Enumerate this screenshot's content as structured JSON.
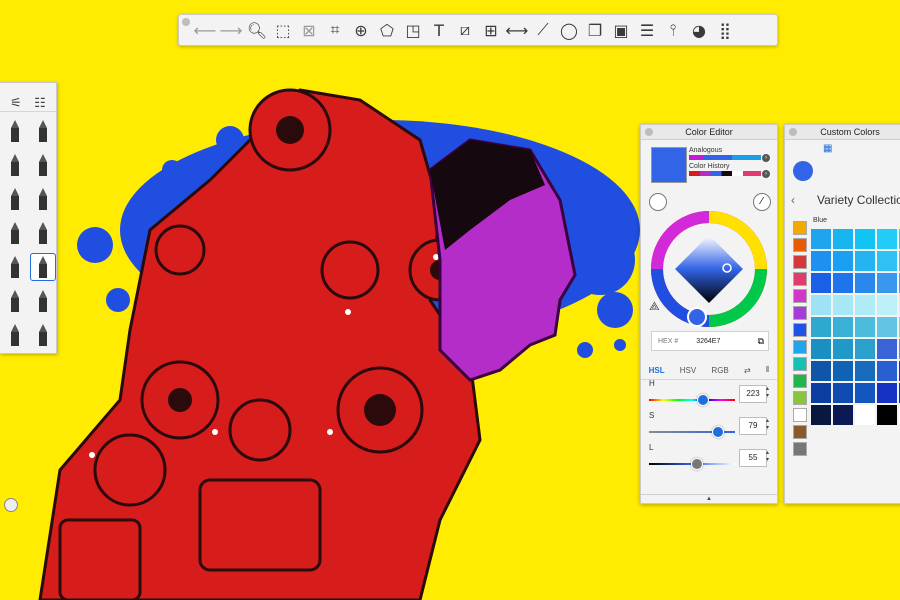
{
  "app": {
    "toolbar": {
      "tools": [
        {
          "icon": "undo-icon",
          "glyph": "⟵",
          "dim": true
        },
        {
          "icon": "redo-icon",
          "glyph": "⟶",
          "dim": true
        },
        {
          "icon": "zoom-icon",
          "glyph": "🔍︎"
        },
        {
          "icon": "select-rect-icon",
          "glyph": "⬚"
        },
        {
          "icon": "clear-selection-icon",
          "glyph": "⊠",
          "dim": true
        },
        {
          "icon": "crop-icon",
          "glyph": "⌗"
        },
        {
          "icon": "add-transform-icon",
          "glyph": "⊕"
        },
        {
          "icon": "distort-icon",
          "glyph": "⬠"
        },
        {
          "icon": "fill-icon",
          "glyph": "◳"
        },
        {
          "icon": "text-icon",
          "glyph": "T"
        },
        {
          "icon": "ruler-icon",
          "glyph": "⧄"
        },
        {
          "icon": "perspective-grid-icon",
          "glyph": "⊞"
        },
        {
          "icon": "symmetry-icon",
          "glyph": "⟷"
        },
        {
          "icon": "stroke-tool-icon",
          "glyph": "⟋"
        },
        {
          "icon": "ellipse-guide-icon",
          "glyph": "◯"
        },
        {
          "icon": "shapes-icon",
          "glyph": "❐"
        },
        {
          "icon": "image-import-icon",
          "glyph": "▣"
        },
        {
          "icon": "layers-icon",
          "glyph": "☰"
        },
        {
          "icon": "brush-library-icon",
          "glyph": "⫯"
        },
        {
          "icon": "color-wheel-icon",
          "glyph": "◕"
        },
        {
          "icon": "color-library-icon",
          "glyph": "⣿"
        }
      ]
    },
    "brushes": {
      "header_icons": [
        "brush-settings-icon",
        "brush-sets-icon"
      ]
    },
    "color_editor": {
      "title": "Color Editor",
      "current_color": "#3264E7",
      "harmony_label": "Analogous",
      "history_label": "Color History",
      "hex_label": "HEX #",
      "hex_value": "3264E7",
      "modes": [
        "HSL",
        "HSV",
        "RGB"
      ],
      "active_mode": "HSL",
      "sliders": [
        {
          "label": "H",
          "value": "223",
          "fraction": 0.62
        },
        {
          "label": "S",
          "value": "79",
          "fraction": 0.79
        },
        {
          "label": "L",
          "value": "55",
          "fraction": 0.55
        }
      ]
    },
    "custom_colors": {
      "title": "Custom Colors",
      "collection_title": "Variety Collection",
      "group_label": "Blue",
      "swatch": "#3264E7",
      "grid": [
        "#1fa4ee",
        "#18b4f0",
        "#12c4f4",
        "#22ccf6",
        "#23d0f5",
        "#1e90f0",
        "#1aa0f2",
        "#25b4f2",
        "#32bff2",
        "#45c5f2",
        "#1b5fe6",
        "#1e74ea",
        "#2a88ec",
        "#3b96ee",
        "#4fa0ef",
        "#9ee3f4",
        "#a6e8f6",
        "#b0ecf7",
        "#bdf0f9",
        "#c9f3fa",
        "#2fa8d0",
        "#39b1d6",
        "#4cbcdc",
        "#64c5e2",
        "#7ccfe6",
        "#1c8fc2",
        "#2199c8",
        "#2c9fcc",
        "#3b63d8",
        "#6a8ae0",
        "#0f56a8",
        "#1062b4",
        "#176cbe",
        "#2a5fd2",
        "#1d2ec4",
        "#0b3ea0",
        "#0f4bb0",
        "#1256be",
        "#1531c6",
        "#1b1fd0",
        "#0a1740",
        "#0b1a55",
        "#ffffff",
        "#000000",
        "#ffffff"
      ],
      "strip": [
        "#f2a900",
        "#e85b00",
        "#d43838",
        "#e23a6c",
        "#d338c8",
        "#a63dd8",
        "#1f52e6",
        "#1fa4ee",
        "#16c1b3",
        "#22b64a",
        "#8ac43a",
        "#ffffff",
        "#8b5a2b",
        "#777777"
      ]
    }
  }
}
